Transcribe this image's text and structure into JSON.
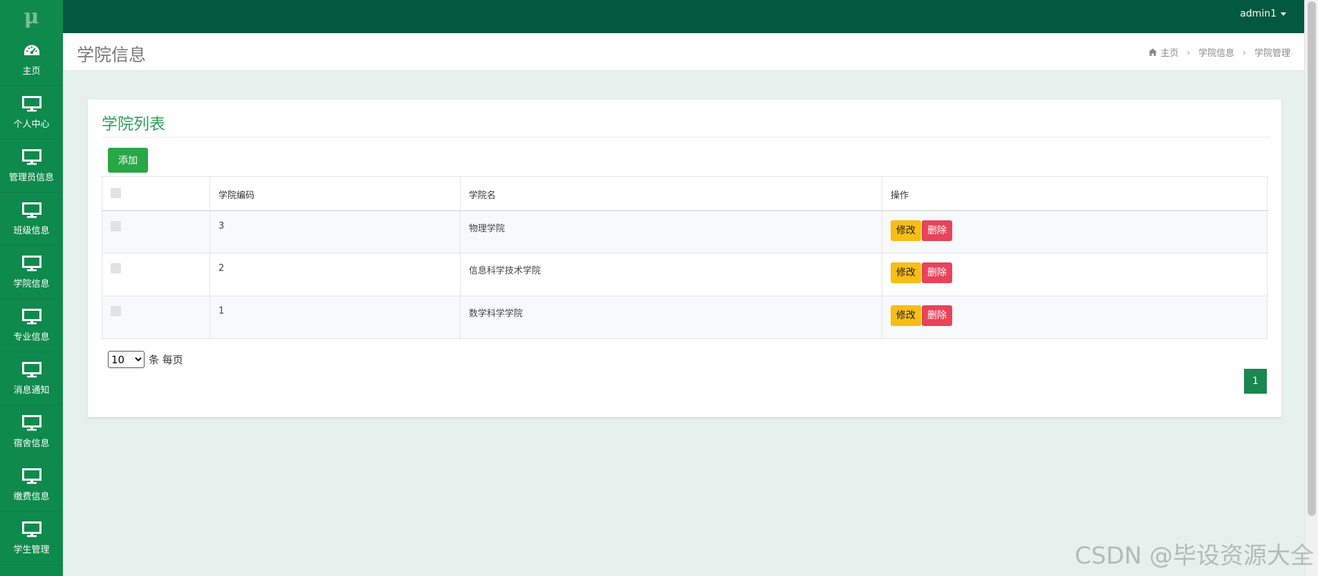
{
  "app": {
    "logo": "μ",
    "user": "admin1"
  },
  "sidebar": {
    "items": [
      {
        "label": "主页",
        "icon": "dashboard-icon"
      },
      {
        "label": "个人中心",
        "icon": "monitor-icon"
      },
      {
        "label": "管理员信息",
        "icon": "monitor-icon"
      },
      {
        "label": "班级信息",
        "icon": "monitor-icon"
      },
      {
        "label": "学院信息",
        "icon": "monitor-icon"
      },
      {
        "label": "专业信息",
        "icon": "monitor-icon"
      },
      {
        "label": "消息通知",
        "icon": "monitor-icon"
      },
      {
        "label": "宿舍信息",
        "icon": "monitor-icon"
      },
      {
        "label": "缴费信息",
        "icon": "monitor-icon"
      },
      {
        "label": "学生管理",
        "icon": "monitor-icon"
      }
    ]
  },
  "header": {
    "title": "学院信息",
    "breadcrumb": [
      "主页",
      "学院信息",
      "学院管理"
    ]
  },
  "panel": {
    "title": "学院列表",
    "add_label": "添加",
    "columns": [
      "",
      "学院编码",
      "学院名",
      "操作"
    ],
    "rows": [
      {
        "code": "3",
        "name": "物理学院"
      },
      {
        "code": "2",
        "name": "信息科学技术学院"
      },
      {
        "code": "1",
        "name": "数学科学学院"
      }
    ],
    "edit_label": "修改",
    "delete_label": "删除",
    "page_size": "10",
    "page_size_suffix": "条 每页",
    "current_page": "1"
  },
  "watermark": "CSDN @毕设资源大全",
  "colors": {
    "sidebar": "#0e8a4c",
    "topbar": "#03593d",
    "accent": "#2f9e5c",
    "add_button": "#28a745",
    "edit_button": "#f8bd16",
    "delete_button": "#e8435a"
  }
}
